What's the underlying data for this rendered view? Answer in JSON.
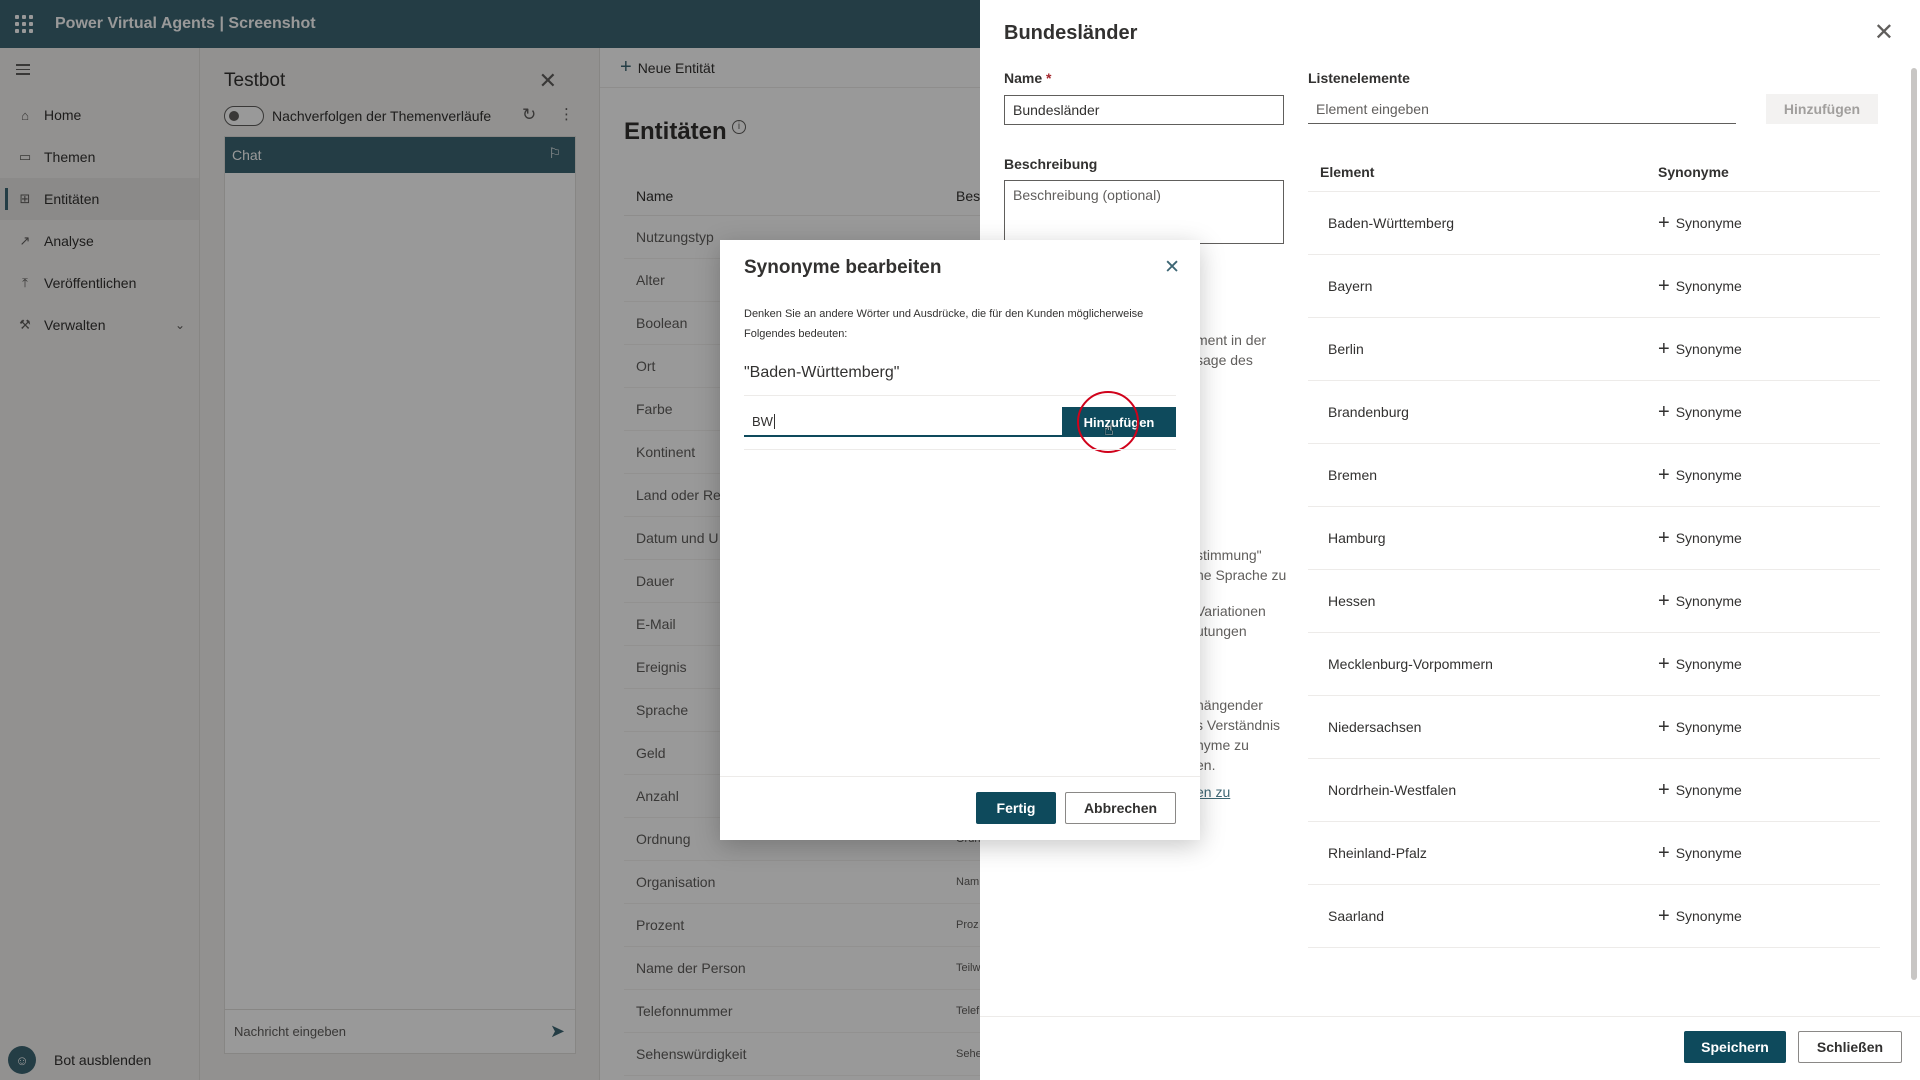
{
  "topbar": {
    "app_title": "Power Virtual Agents | Screenshot"
  },
  "leftnav": {
    "items": [
      {
        "label": "Home",
        "icon": "home-icon"
      },
      {
        "label": "Themen",
        "icon": "chat-icon"
      },
      {
        "label": "Entitäten",
        "icon": "entities-icon",
        "active": true
      },
      {
        "label": "Analyse",
        "icon": "chart-icon"
      },
      {
        "label": "Veröffentlichen",
        "icon": "upload-icon"
      },
      {
        "label": "Verwalten",
        "icon": "wrench-icon"
      }
    ],
    "bot_hide_label": "Bot ausblenden"
  },
  "testbot": {
    "title": "Testbot",
    "toggle_label": "Nachverfolgen der Themenverläufe",
    "chat_header": "Chat",
    "input_placeholder": "Nachricht eingeben"
  },
  "main": {
    "new_entity_label": "Neue Entität",
    "title": "Entitäten",
    "col_name": "Name",
    "col_desc": "Besc",
    "rows": [
      {
        "name": "Nutzungstyp",
        "desc": ""
      },
      {
        "name": "Alter",
        "desc": ""
      },
      {
        "name": "Boolean",
        "desc": ""
      },
      {
        "name": "Ort",
        "desc": ""
      },
      {
        "name": "Farbe",
        "desc": ""
      },
      {
        "name": "Kontinent",
        "desc": ""
      },
      {
        "name": "Land oder Re",
        "desc": ""
      },
      {
        "name": "Datum und U",
        "desc": ""
      },
      {
        "name": "Dauer",
        "desc": ""
      },
      {
        "name": "E-Mail",
        "desc": ""
      },
      {
        "name": "Ereignis",
        "desc": ""
      },
      {
        "name": "Sprache",
        "desc": ""
      },
      {
        "name": "Geld",
        "desc": ""
      },
      {
        "name": "Anzahl",
        "desc": ""
      },
      {
        "name": "Ordnung",
        "desc": "Ordn"
      },
      {
        "name": "Organisation",
        "desc": "Nam"
      },
      {
        "name": "Prozent",
        "desc": "Proz"
      },
      {
        "name": "Name der Person",
        "desc": "Teilw"
      },
      {
        "name": "Telefonnummer",
        "desc": "Telef"
      },
      {
        "name": "Sehenswürdigkeit",
        "desc": "Sehe"
      }
    ]
  },
  "panel": {
    "title": "Bundesländer",
    "name_label": "Name",
    "name_required": "*",
    "name_value": "Bundesländer",
    "desc_label": "Beschreibung",
    "desc_placeholder": "Beschreibung (optional)",
    "list_label": "Listenelemente",
    "element_placeholder": "Element eingeben",
    "add_label": "Hinzufügen",
    "hint_lines_1": [
      "ment in der",
      "sage des"
    ],
    "hint_lines_2": [
      "stimmung\"",
      "he Sprache zu"
    ],
    "hint_lines_3": [
      "Variationen",
      "utungen"
    ],
    "hint_lines_4": [
      "hängender",
      "s Verständnis",
      "nyme zu",
      "en."
    ],
    "hint_link": "en zu",
    "col_element": "Element",
    "col_synonyms": "Synonyme",
    "synonym_button": "Synonyme",
    "elements": [
      "Baden-Württemberg",
      "Bayern",
      "Berlin",
      "Brandenburg",
      "Bremen",
      "Hamburg",
      "Hessen",
      "Mecklenburg-Vorpommern",
      "Niedersachsen",
      "Nordrhein-Westfalen",
      "Rheinland-Pfalz",
      "Saarland"
    ],
    "save_label": "Speichern",
    "close_label": "Schließen"
  },
  "modal": {
    "title": "Synonyme bearbeiten",
    "description": "Denken Sie an andere Wörter und Ausdrücke, die für den Kunden möglicherweise Folgendes bedeuten:",
    "value": "\"Baden-Württemberg\"",
    "input_value": "BW",
    "add_label": "Hinzufügen",
    "done_label": "Fertig",
    "cancel_label": "Abbrechen"
  }
}
